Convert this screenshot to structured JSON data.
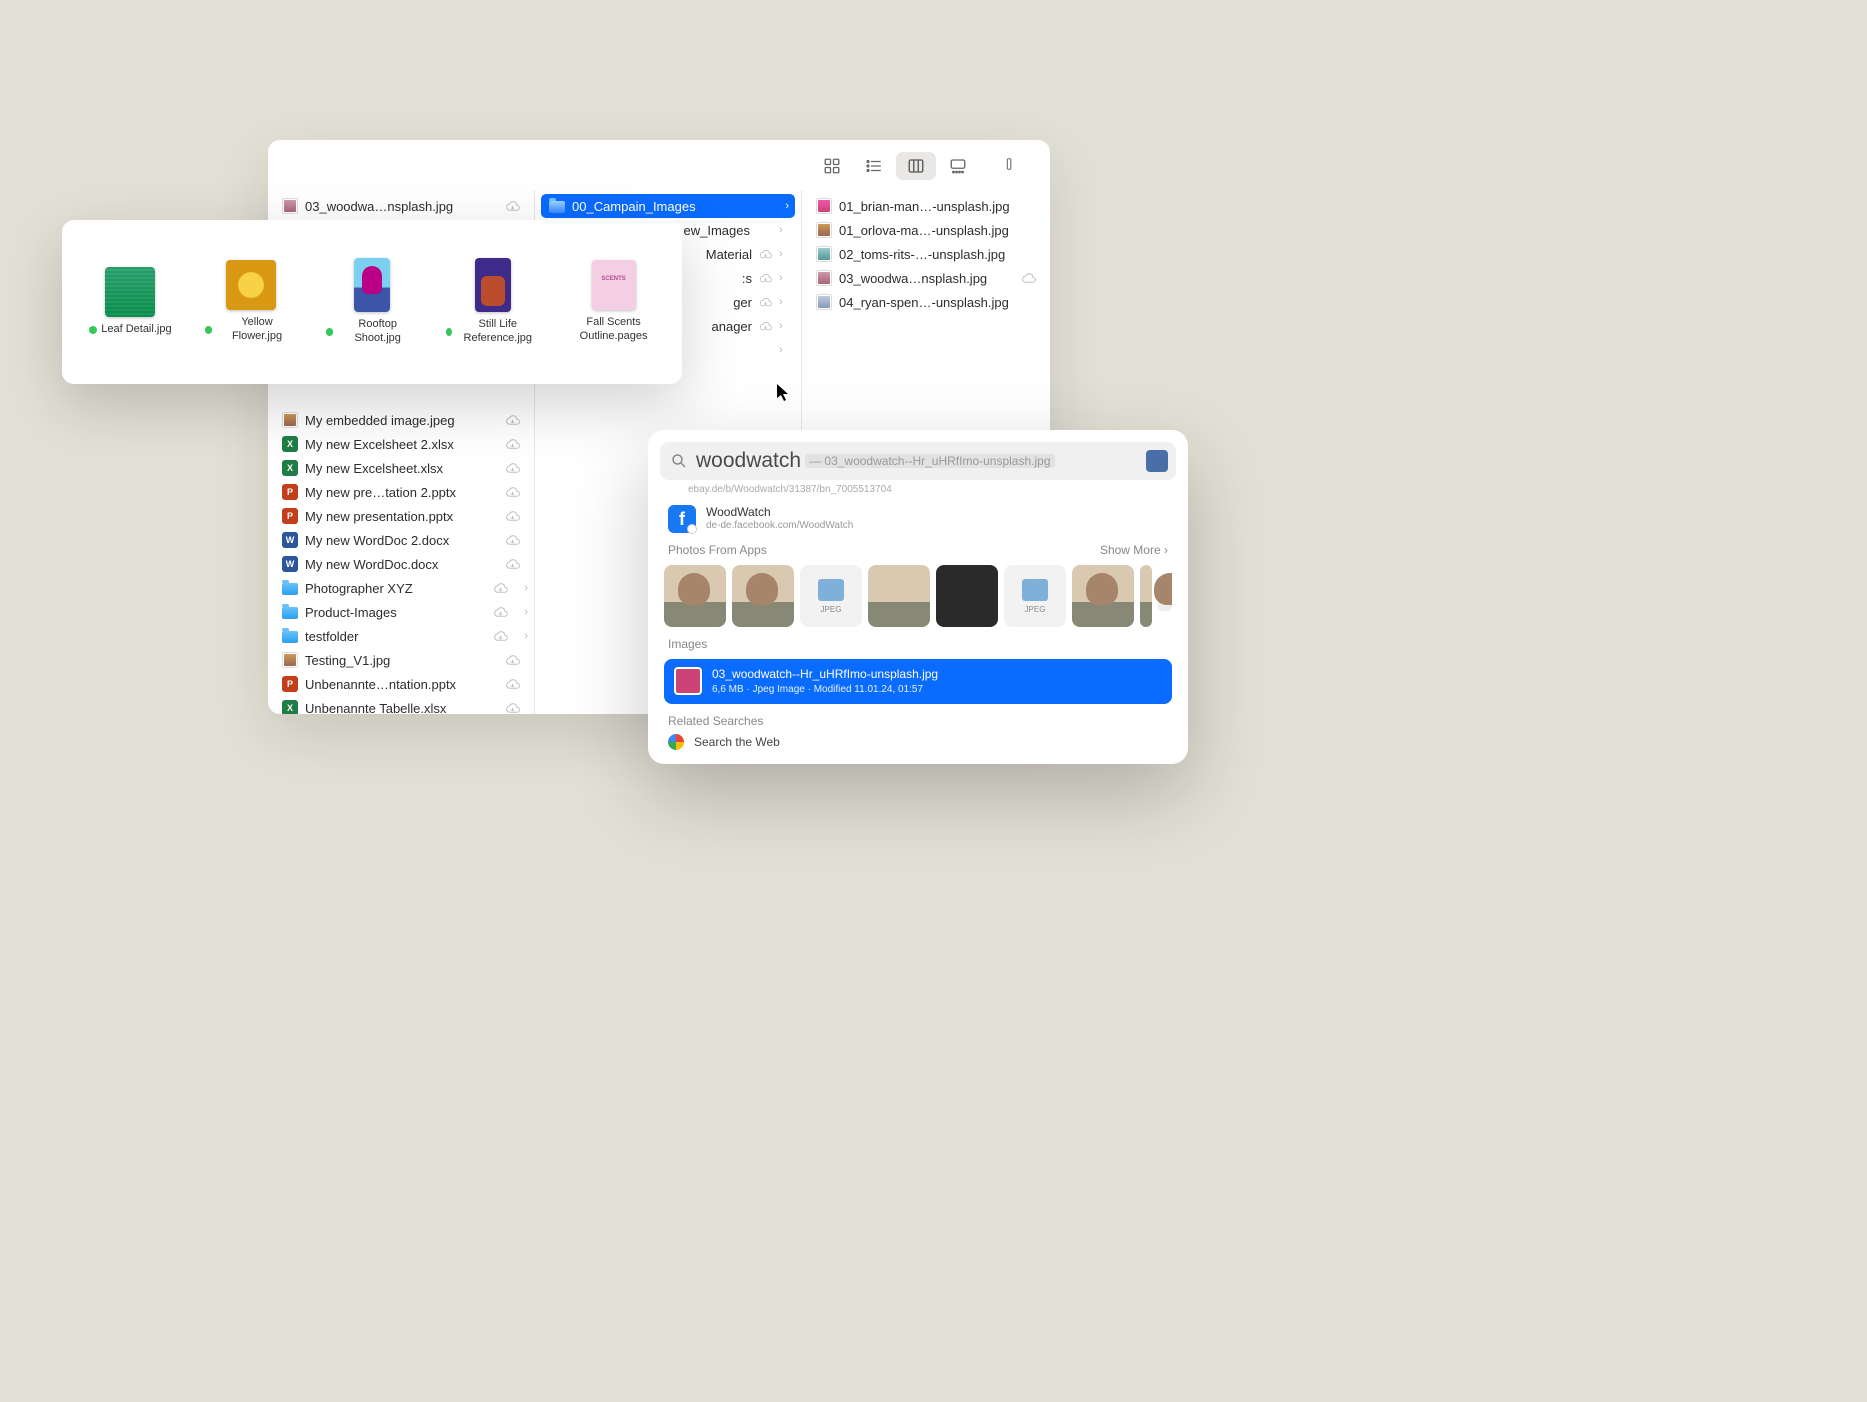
{
  "finder": {
    "col1": {
      "top": "03_woodwa…nsplash.jpg",
      "items": [
        {
          "name": "My embedded image.jpeg",
          "kind": "img",
          "cloud": true
        },
        {
          "name": "My new Excelsheet 2.xlsx",
          "kind": "xls",
          "cloud": true
        },
        {
          "name": "My new Excelsheet.xlsx",
          "kind": "xls",
          "cloud": true
        },
        {
          "name": "My new pre…tation 2.pptx",
          "kind": "ppt",
          "cloud": true
        },
        {
          "name": "My new presentation.pptx",
          "kind": "ppt",
          "cloud": true
        },
        {
          "name": "My new WordDoc 2.docx",
          "kind": "doc",
          "cloud": true
        },
        {
          "name": "My new WordDoc.docx",
          "kind": "doc",
          "cloud": true
        },
        {
          "name": "Photographer XYZ",
          "kind": "folder",
          "cloud": true,
          "chev": true
        },
        {
          "name": "Product-Images",
          "kind": "folder",
          "cloud": true,
          "chev": true
        },
        {
          "name": "testfolder",
          "kind": "folder",
          "cloud": true,
          "chev": true
        },
        {
          "name": "Testing_V1.jpg",
          "kind": "img",
          "cloud": true
        },
        {
          "name": "Unbenannte…ntation.pptx",
          "kind": "ppt",
          "cloud": true
        },
        {
          "name": "Unbenannte Tabelle.xlsx",
          "kind": "xls",
          "cloud": true
        }
      ]
    },
    "col2": {
      "selected": "00_Campain_Images",
      "items": [
        {
          "name": "ew_Images",
          "chev": true
        },
        {
          "name": "Material",
          "cloud": true,
          "chev": true
        },
        {
          "name": ":s",
          "cloud": true,
          "chev": true
        },
        {
          "name": "ger",
          "cloud": true,
          "chev": true
        },
        {
          "name": "anager",
          "cloud": true,
          "chev": true
        },
        {
          "name": "",
          "chev": true
        }
      ]
    },
    "col3": {
      "items": [
        {
          "name": "01_brian-man…-unsplash.jpg",
          "kind": "img",
          "pc": "p1"
        },
        {
          "name": "01_orlova-ma…-unsplash.jpg",
          "kind": "img",
          "pc": "p2"
        },
        {
          "name": "02_toms-rits-…-unsplash.jpg",
          "kind": "img",
          "pc": "p3"
        },
        {
          "name": "03_woodwa…nsplash.jpg",
          "kind": "img",
          "pc": "p4",
          "cloudOutline": true
        },
        {
          "name": "04_ryan-spen…-unsplash.jpg",
          "kind": "img",
          "pc": "p5"
        }
      ]
    }
  },
  "gallery": {
    "items": [
      {
        "label": "Leaf Detail.jpg",
        "dot": "green",
        "thumb": "leaf"
      },
      {
        "label": "Yellow Flower.jpg",
        "dot": "green",
        "thumb": "yellow"
      },
      {
        "label": "Rooftop Shoot.jpg",
        "dot": "green",
        "thumb": "rooftop"
      },
      {
        "label": "Still Life Reference.jpg",
        "dot": "green",
        "thumb": "still"
      },
      {
        "label": "Fall Scents Outline.pages",
        "dot": "",
        "thumb": "pages"
      }
    ]
  },
  "spotlight": {
    "query": "woodwatch",
    "suffix": " — 03_woodwatch--Hr_uHRfImo-unsplash.jpg",
    "partial": "ebay.de/b/Woodwatch/31387/bn_7005513704",
    "fb": {
      "title": "WoodWatch",
      "url": "de-de.facebook.com/WoodWatch"
    },
    "photosSection": "Photos From Apps",
    "showMore": "Show More",
    "imagesSection": "Images",
    "result": {
      "name": "03_woodwatch--Hr_uHRfImo-unsplash.jpg",
      "meta": "6,6 MB · Jpeg Image · Modified 11.01.24, 01:57"
    },
    "relatedSection": "Related Searches",
    "web": "Search the Web",
    "jpegLabel": "JPEG"
  }
}
